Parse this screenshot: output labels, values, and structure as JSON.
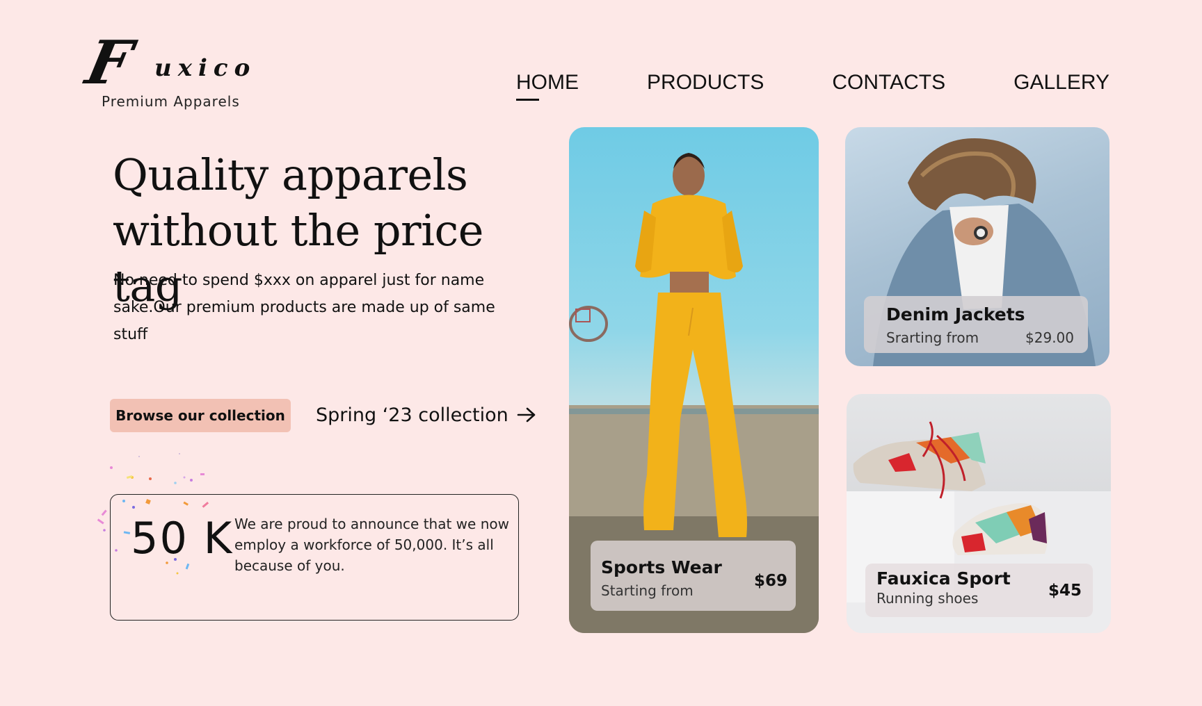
{
  "brand": {
    "logo_initial": "F",
    "logo_rest": "uxico",
    "tagline": "Premium Apparels"
  },
  "nav": {
    "items": [
      {
        "label": "HOME",
        "active": true
      },
      {
        "label": "PRODUCTS",
        "active": false
      },
      {
        "label": "CONTACTS",
        "active": false
      },
      {
        "label": "GALLERY",
        "active": false
      }
    ]
  },
  "hero": {
    "title_line1": "Quality apparels",
    "title_line2": "without the price tag",
    "description": "No need to spend $xxx on apparel just for name sake.Our premium products are made up of same stuff",
    "browse_button": "Browse our collection",
    "spring_link": "Spring ‘23 collection",
    "spring_link_icon": "arrow-right-icon"
  },
  "stats": {
    "number": "50 K",
    "text": "We are proud to announce that we now employ a workforce of 50,000. It’s all because of you."
  },
  "products": {
    "sports": {
      "title": "Sports Wear",
      "subtitle": "Starting from",
      "price": "$69"
    },
    "denim": {
      "title": "Denim Jackets",
      "subtitle": "Srarting from",
      "price": "$29.00"
    },
    "shoes": {
      "title": "Fauxica Sport",
      "subtitle": "Running shoes",
      "price": "$45"
    }
  },
  "colors": {
    "background": "#fde8e7",
    "button": "#f2c1b4",
    "text": "#111111",
    "tracksuit": "#f2b21a"
  }
}
